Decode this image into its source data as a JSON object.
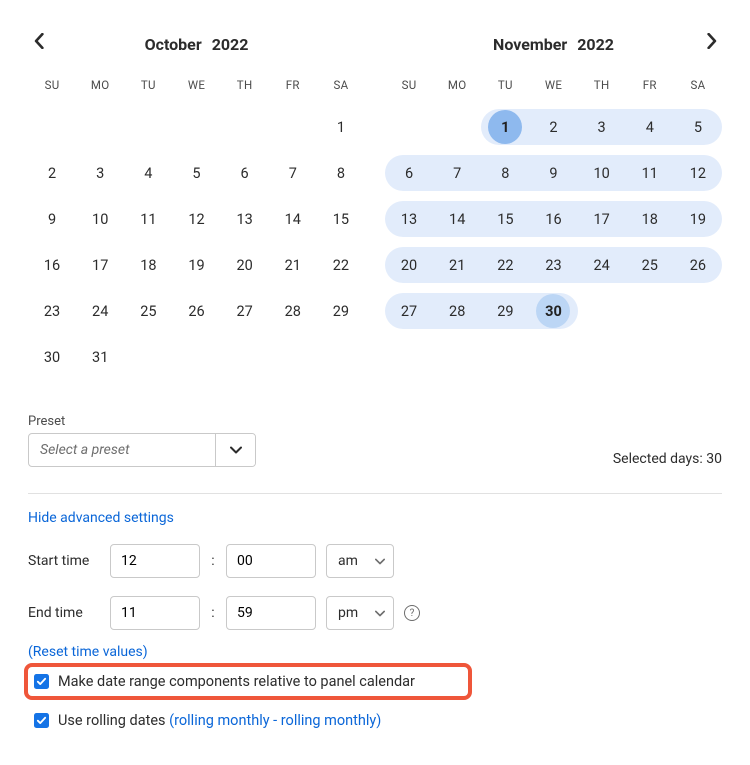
{
  "dow": [
    "SU",
    "MO",
    "TU",
    "WE",
    "TH",
    "FR",
    "SA"
  ],
  "left": {
    "month": "October",
    "year": "2022",
    "leading_blanks": 6,
    "days_in_month": 31
  },
  "right": {
    "month": "November",
    "year": "2022",
    "leading_blanks": 2,
    "days_in_month": 30,
    "selected_start": 1,
    "selected_end": 30
  },
  "preset": {
    "label": "Preset",
    "placeholder": "Select a preset"
  },
  "selected_days_label": "Selected days:",
  "selected_days_value": "30",
  "advanced_toggle": "Hide advanced settings",
  "start_time": {
    "label": "Start time",
    "hour": "12",
    "minute": "00",
    "ampm": "am"
  },
  "end_time": {
    "label": "End time",
    "hour": "11",
    "minute": "59",
    "ampm": "pm"
  },
  "reset_label": "(Reset time values)",
  "checkbox_relative": "Make date range components relative to panel calendar",
  "checkbox_rolling": "Use rolling dates",
  "rolling_detail": "(rolling monthly - rolling monthly)"
}
